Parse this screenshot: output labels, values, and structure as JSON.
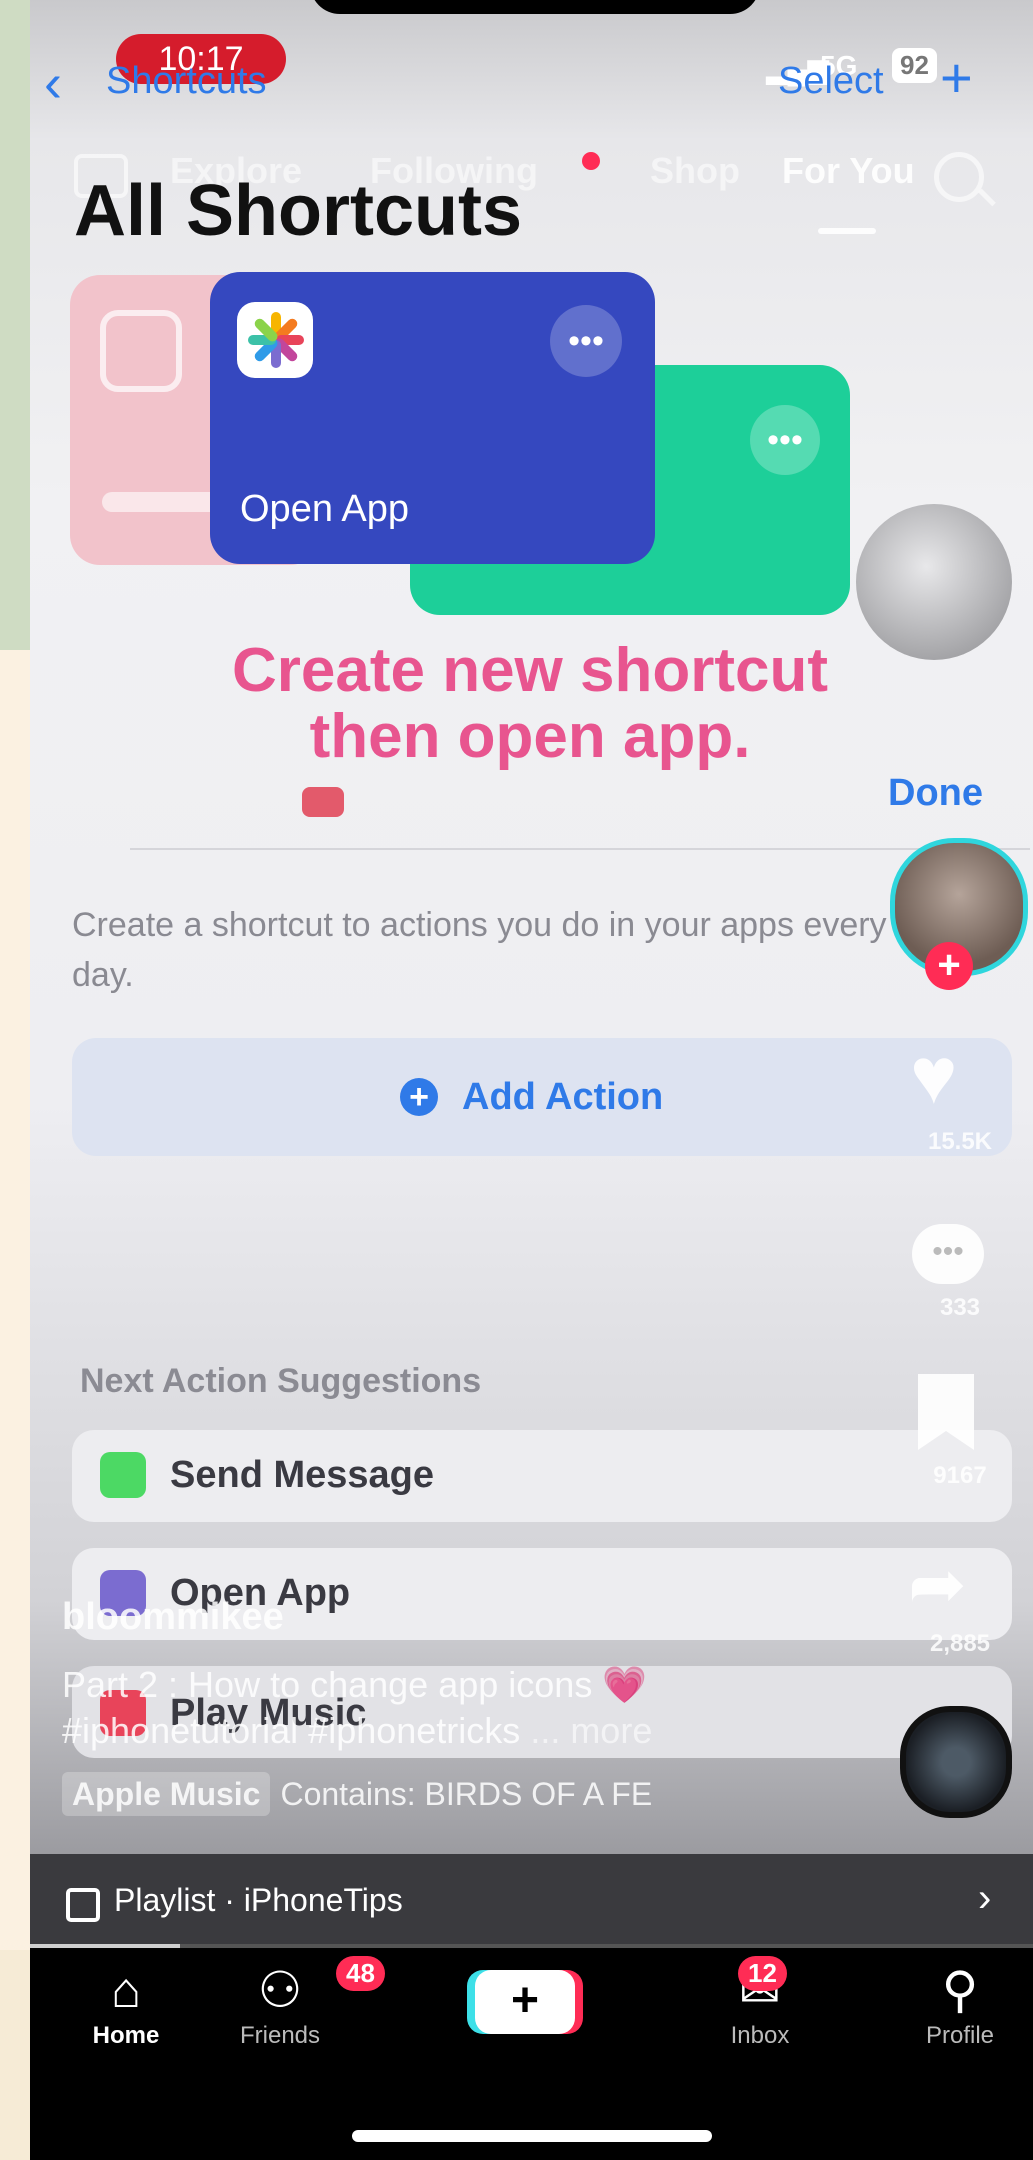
{
  "status_bar": {
    "time": "10:17",
    "network": "5G",
    "battery": "92"
  },
  "shortcuts_nav": {
    "back_label": "Shortcuts",
    "select_label": "Select",
    "add_label": "+"
  },
  "tiktok_tabs": [
    "Explore",
    "Following",
    "Shop",
    "For You"
  ],
  "page_title": "All Shortcuts",
  "cards": {
    "open_app_label": "Open App"
  },
  "overlay_caption": {
    "line1": "Create new shortcut",
    "line2": "then open app."
  },
  "editor": {
    "done_label": "Done",
    "description": "Create a shortcut to actions you do in your apps every day.",
    "add_action_label": "Add Action",
    "suggestions_title": "Next Action Suggestions",
    "suggestions": [
      {
        "label": "Send Message",
        "color": "#4cd964"
      },
      {
        "label": "Open App",
        "color": "#7b6cd0"
      },
      {
        "label": "Play Music",
        "color": "#e8445a"
      }
    ]
  },
  "rail": {
    "likes": "15.5K",
    "comments": "333",
    "saves": "9167",
    "shares": "2,885"
  },
  "post": {
    "username": "bloommikee",
    "caption": "Part 2 : How to change app icons 💗 #iphonetutorial #iphonetricks",
    "more_label": "... more",
    "music_chip": "Apple Music",
    "music_text": "Contains: BIRDS OF A FE"
  },
  "playlist": {
    "label": "Playlist · iPhoneTips",
    "progress": 0.15
  },
  "bottom_nav": {
    "home": "Home",
    "friends": "Friends",
    "friends_badge": "48",
    "inbox": "Inbox",
    "inbox_badge": "12",
    "profile": "Profile"
  },
  "colors": {
    "tiktok_red": "#ff2c55",
    "ios_blue": "#2f7ae8",
    "overlay_pink": "#e8558f"
  }
}
